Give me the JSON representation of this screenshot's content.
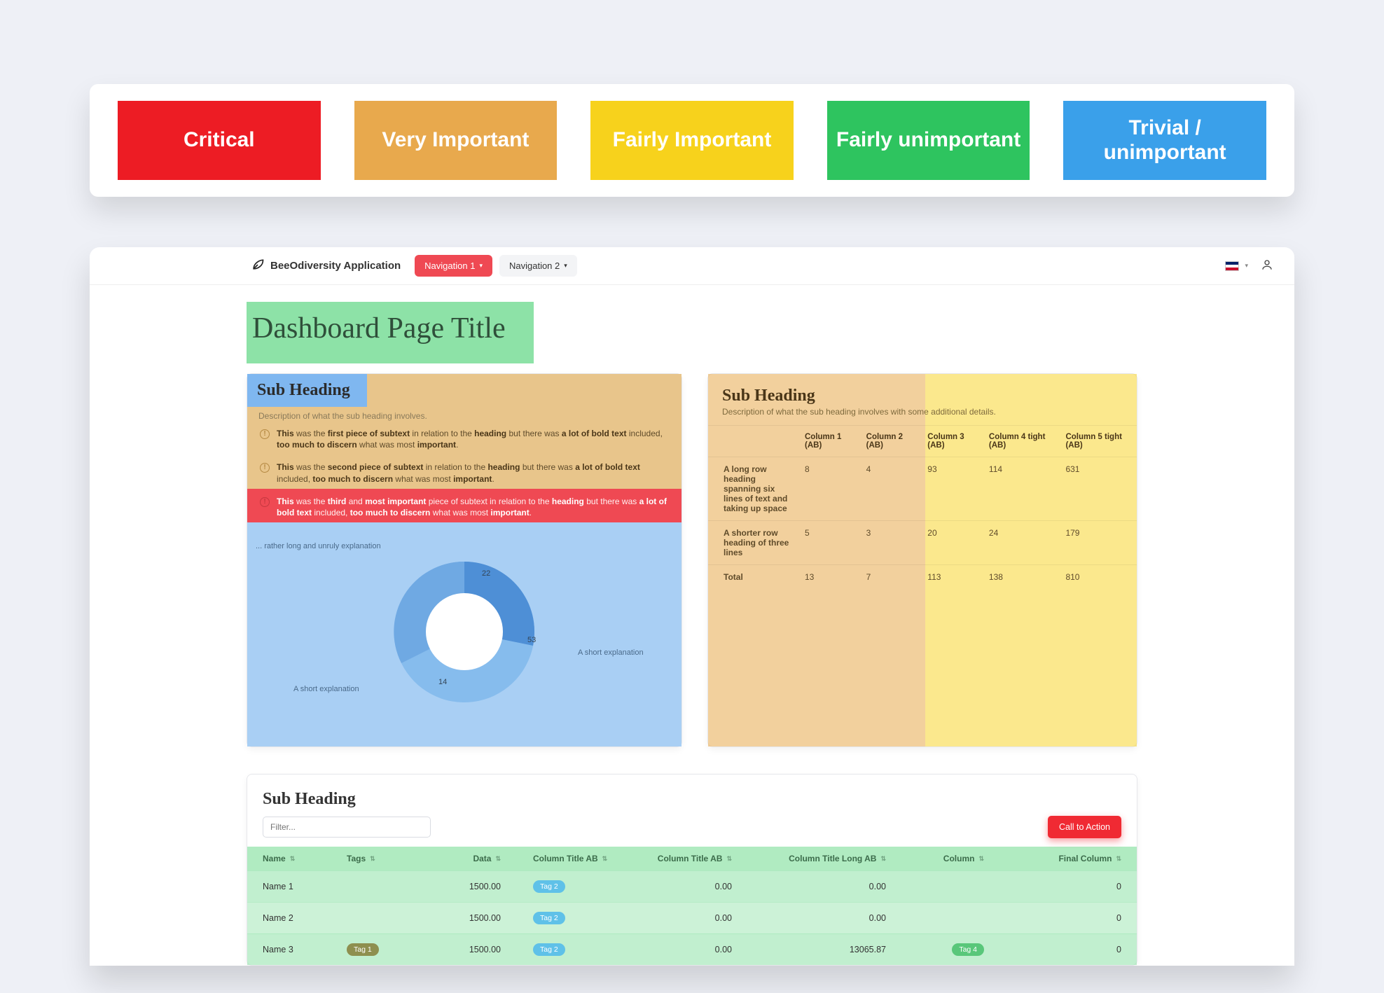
{
  "legend": {
    "critical": "Critical",
    "very": "Very Important",
    "fairly_imp": "Fairly Important",
    "fairly_un": "Fairly unimportant",
    "trivial": "Trivial / unimportant"
  },
  "brand": "BeeOdiversity Application",
  "nav1": "Navigation 1",
  "nav2": "Navigation 2",
  "page_title": "Dashboard Page Title",
  "left": {
    "sub_heading": "Sub Heading",
    "desc": "Description of what the sub heading involves.",
    "b1": {
      "a": "This",
      "b": " was the ",
      "c": "first piece of subtext",
      "d": " in relation to the ",
      "e": "heading",
      "f": " but there was ",
      "g": "a lot of bold text",
      "h": " included, ",
      "i": "too much to discern",
      "j": " what was most ",
      "k": "important",
      "l": "."
    },
    "b2": {
      "a": "This",
      "b": " was the ",
      "c": "second piece of subtext",
      "d": " in relation to the ",
      "e": "heading",
      "f": " but there was ",
      "g": "a lot of bold text",
      "h": " included, ",
      "i": "too much to discern",
      "j": " what was most ",
      "k": "important",
      "l": "."
    },
    "b3": {
      "a": "This",
      "b": " was the ",
      "c": "third",
      "d": " and ",
      "e": "most important",
      "f": " piece of subtext in relation to the ",
      "g": "heading",
      "h": " but there was ",
      "i": "a lot of bold text",
      "j": " included, ",
      "k": "too much to discern",
      "l": " what was most ",
      "m": "important",
      "n": "."
    },
    "chart_label_long": "... rather long and unruly explanation",
    "chart_label_short1": "A short explanation",
    "chart_label_short2": "A short explanation",
    "v1": "22",
    "v2": "53",
    "v3": "14"
  },
  "right": {
    "sub_heading": "Sub Heading",
    "desc": "Description of what the sub heading involves with some additional details.",
    "cols": [
      "",
      "Column 1 (AB)",
      "Column 2 (AB)",
      "Column 3 (AB)",
      "Column 4 tight (AB)",
      "Column 5 tight (AB)"
    ],
    "rows": [
      {
        "h": "A long row heading spanning six lines of text and taking up space",
        "c": [
          "8",
          "4",
          "93",
          "114",
          "631"
        ]
      },
      {
        "h": "A shorter row heading of three lines",
        "c": [
          "5",
          "3",
          "20",
          "24",
          "179"
        ]
      },
      {
        "h": "Total",
        "c": [
          "13",
          "7",
          "113",
          "138",
          "810"
        ]
      }
    ]
  },
  "bottom": {
    "sub_heading": "Sub Heading",
    "filter_placeholder": "Filter...",
    "cta": "Call to Action",
    "cols": [
      "Name",
      "Tags",
      "Data",
      "Column Title AB",
      "Column Title AB",
      "Column Title Long AB",
      "Column",
      "Final Column"
    ],
    "rows": [
      {
        "name": "Name 1",
        "tags": [],
        "data": "1500.00",
        "ab1": "Tag 2",
        "ab2": "0.00",
        "long": "0.00",
        "col": "",
        "final": "0"
      },
      {
        "name": "Name 2",
        "tags": [],
        "data": "1500.00",
        "ab1": "Tag 2",
        "ab2": "0.00",
        "long": "0.00",
        "col": "",
        "final": "0"
      },
      {
        "name": "Name 3",
        "tags": [
          "Tag 1"
        ],
        "data": "1500.00",
        "ab1": "Tag 2",
        "ab2": "0.00",
        "long": "13065.87",
        "col": "Tag 4",
        "final": "0"
      }
    ]
  },
  "chart_data": {
    "type": "pie",
    "variant": "donut",
    "title": "",
    "series": [
      {
        "name": "... rather long and unruly explanation",
        "value": 22
      },
      {
        "name": "A short explanation",
        "value": 53
      },
      {
        "name": "A short explanation",
        "value": 14
      }
    ],
    "data_labels": true,
    "legend_position": "outside"
  }
}
